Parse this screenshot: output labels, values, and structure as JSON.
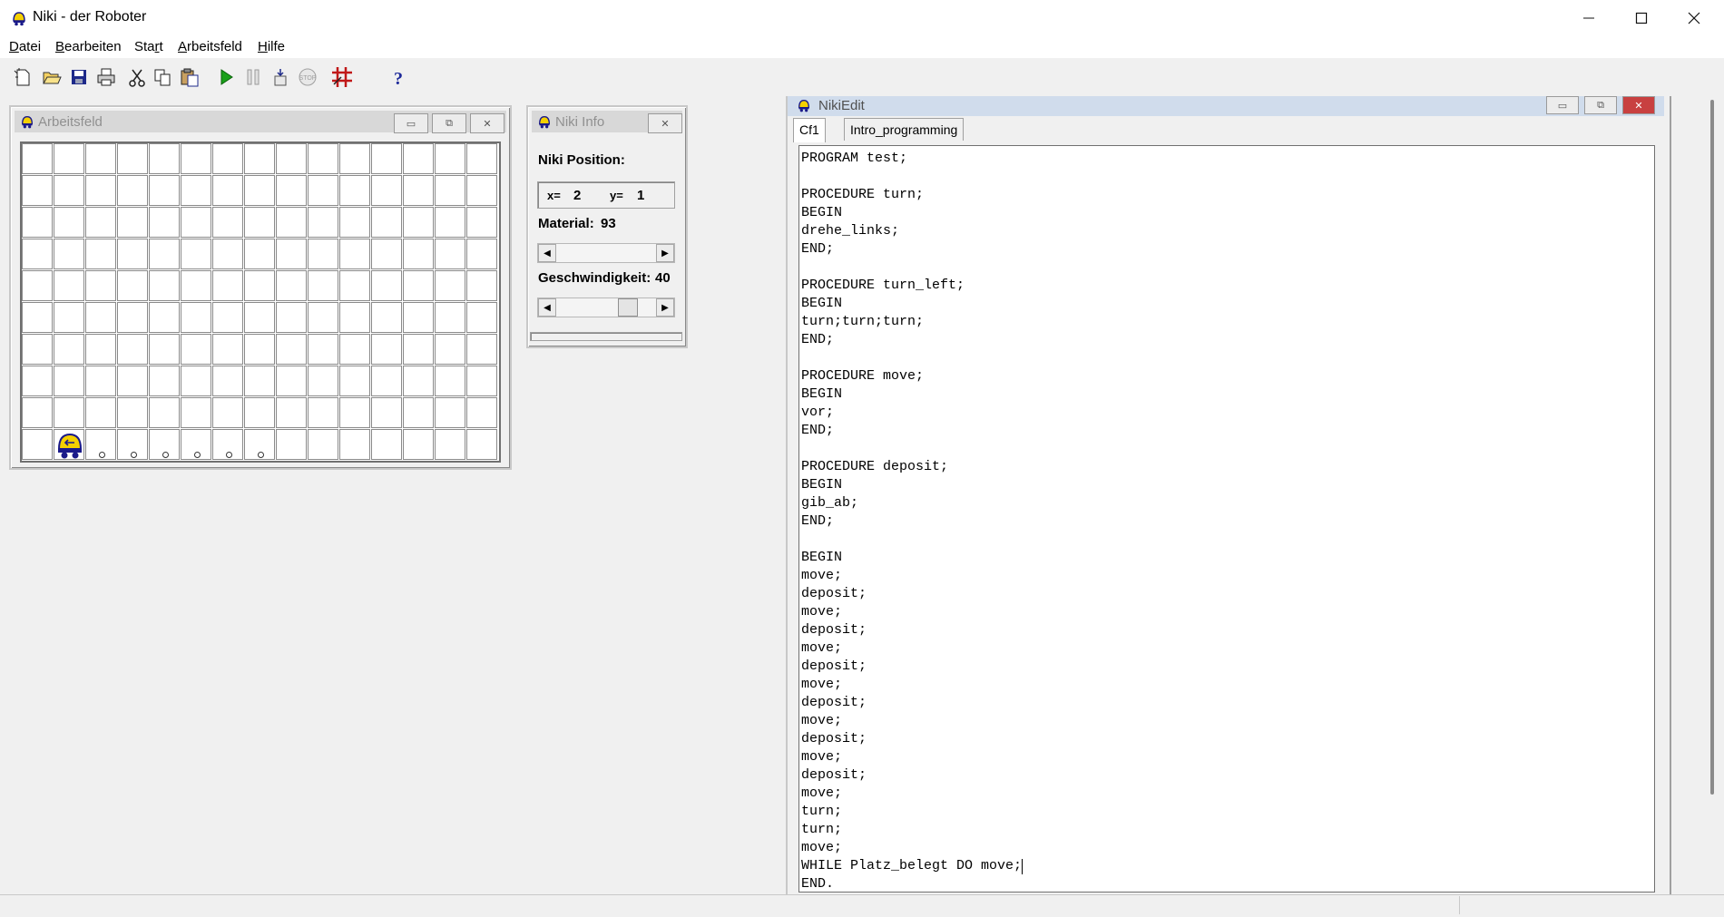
{
  "window": {
    "title": "Niki - der Roboter",
    "controls": [
      "minimize",
      "maximize",
      "close"
    ]
  },
  "menu": [
    {
      "label": "Datei",
      "underline": "D",
      "rest": "atei"
    },
    {
      "label": "Bearbeiten",
      "underline": "B",
      "rest": "earbeiten"
    },
    {
      "label": "Start",
      "pre": "Sta",
      "underline": "r",
      "rest": "t"
    },
    {
      "label": "Arbeitsfeld",
      "underline": "A",
      "rest": "rbeitsfeld"
    },
    {
      "label": "Hilfe",
      "underline": "H",
      "rest": "ilfe"
    }
  ],
  "toolbar": {
    "buttons": [
      "new-icon",
      "open-icon",
      "save-icon",
      "print-icon",
      "cut-icon",
      "copy-icon",
      "paste-icon",
      "run-icon",
      "pause-icon",
      "step-icon",
      "stop-icon",
      "grid-icon",
      "help-icon"
    ]
  },
  "arbeitsfeld": {
    "title": "Arbeitsfeld",
    "cols": 15,
    "rows": 10,
    "robot": {
      "x": 2,
      "y": 1,
      "facing": "west"
    },
    "material_cells": [
      3,
      4,
      5,
      6,
      7,
      8
    ]
  },
  "info": {
    "title": "Niki Info",
    "position_label": "Niki Position:",
    "x_label": "x=",
    "x_value": "2",
    "y_label": "y=",
    "y_value": "1",
    "material_label": "Material:",
    "material_value": "93",
    "speed_label": "Geschwindigkeit:",
    "speed_value": "40",
    "speed_slider_fraction": 0.75
  },
  "editor": {
    "title": "NikiEdit",
    "tabs": [
      {
        "label": "Cf1",
        "active": true
      },
      {
        "label": "Intro_programming",
        "active": false
      }
    ],
    "code": [
      "PROGRAM test;",
      "",
      "PROCEDURE turn;",
      "BEGIN",
      "drehe_links;",
      "END;",
      "",
      "PROCEDURE turn_left;",
      "BEGIN",
      "turn;turn;turn;",
      "END;",
      "",
      "PROCEDURE move;",
      "BEGIN",
      "vor;",
      "END;",
      "",
      "PROCEDURE deposit;",
      "BEGIN",
      "gib_ab;",
      "END;",
      "",
      "BEGIN",
      "move;",
      "deposit;",
      "move;",
      "deposit;",
      "move;",
      "deposit;",
      "move;",
      "deposit;",
      "move;",
      "deposit;",
      "move;",
      "deposit;",
      "move;",
      "turn;",
      "turn;",
      "move;",
      "WHILE Platz_belegt DO move;",
      "END."
    ]
  },
  "colors": {
    "robot_body": "#f5d000",
    "robot_outline": "#1a1a8a",
    "grid_line": "#8a8a8a"
  }
}
